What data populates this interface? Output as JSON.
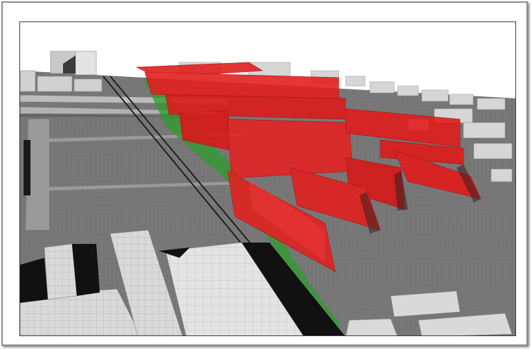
{
  "scene": {
    "kind": "3d-urban-massing-render",
    "colors": {
      "frame_border": "#8d8d8d",
      "sky": "#ffffff",
      "ground": "#7a7a7a",
      "road": "#8a8a8a",
      "context_building": "#d7d7d7",
      "proposed_building": "#e11b1b",
      "proposed_edge": "#b10f0f",
      "green_strip": "#2f9b2f",
      "shadow": "#111111",
      "rail": "#1f1f1f"
    },
    "layers": [
      {
        "name": "context-buildings",
        "color_key": "context_building"
      },
      {
        "name": "proposed-development",
        "color_key": "proposed_building"
      },
      {
        "name": "green-buffer",
        "color_key": "green_strip"
      },
      {
        "name": "rail-line",
        "color_key": "rail"
      }
    ]
  }
}
